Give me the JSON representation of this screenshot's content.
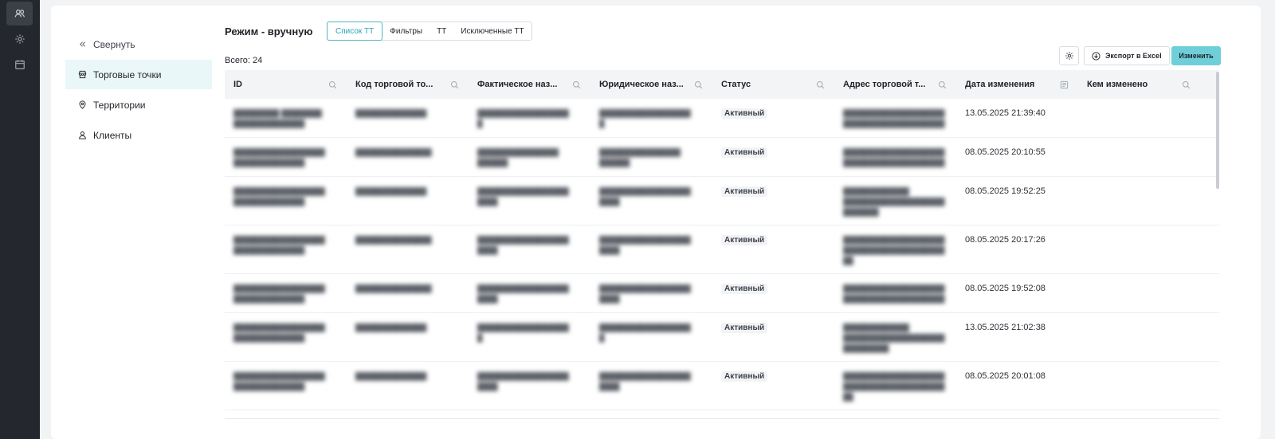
{
  "rail": {
    "items": [
      {
        "icon": "users-icon",
        "active": true
      },
      {
        "icon": "gear-icon",
        "active": false
      },
      {
        "icon": "calendar-icon",
        "active": false
      }
    ]
  },
  "subnav": {
    "collapse_label": "Свернуть",
    "items": [
      {
        "label": "Торговые точки",
        "icon": "store-icon",
        "active": true
      },
      {
        "label": "Территории",
        "icon": "location-pin-icon",
        "active": false
      },
      {
        "label": "Клиенты",
        "icon": "user-icon",
        "active": false
      }
    ]
  },
  "header": {
    "mode_title": "Режим - вручную",
    "tabs": [
      {
        "label": "Список ТТ",
        "active": true
      },
      {
        "label": "Фильтры",
        "active": false
      },
      {
        "label": "ТТ",
        "active": false
      },
      {
        "label": "Исключенные ТТ",
        "active": false
      }
    ],
    "total_label": "Всего: 24",
    "export_label": "Экспорт в Excel",
    "edit_label": "Изменить"
  },
  "colors": {
    "accent": "#6ecfd9",
    "accent_text": "#2aa4b6",
    "rail_bg": "#24272d",
    "active_nav_bg": "#eaf7f8"
  },
  "table": {
    "columns": [
      {
        "label": "ID",
        "icon": "search-icon"
      },
      {
        "label": "Код торговой то...",
        "icon": "search-icon"
      },
      {
        "label": "Фактическое наз...",
        "icon": "search-icon"
      },
      {
        "label": "Юридическое наз...",
        "icon": "search-icon"
      },
      {
        "label": "Статус",
        "icon": "search-icon"
      },
      {
        "label": "Адрес торговой т...",
        "icon": "search-icon"
      },
      {
        "label": "Дата изменения",
        "icon": "filter-list-icon"
      },
      {
        "label": "Кем изменено",
        "icon": "search-icon"
      }
    ],
    "rows": [
      {
        "status": "Активный",
        "date": "13.05.2025 21:39:40"
      },
      {
        "status": "Активный",
        "date": "08.05.2025 20:10:55"
      },
      {
        "status": "Активный",
        "date": "08.05.2025 19:52:25"
      },
      {
        "status": "Активный",
        "date": "08.05.2025 20:17:26"
      },
      {
        "status": "Активный",
        "date": "08.05.2025 19:52:08"
      },
      {
        "status": "Активный",
        "date": "13.05.2025 21:02:38"
      },
      {
        "status": "Активный",
        "date": "08.05.2025 20:01:08"
      }
    ]
  }
}
